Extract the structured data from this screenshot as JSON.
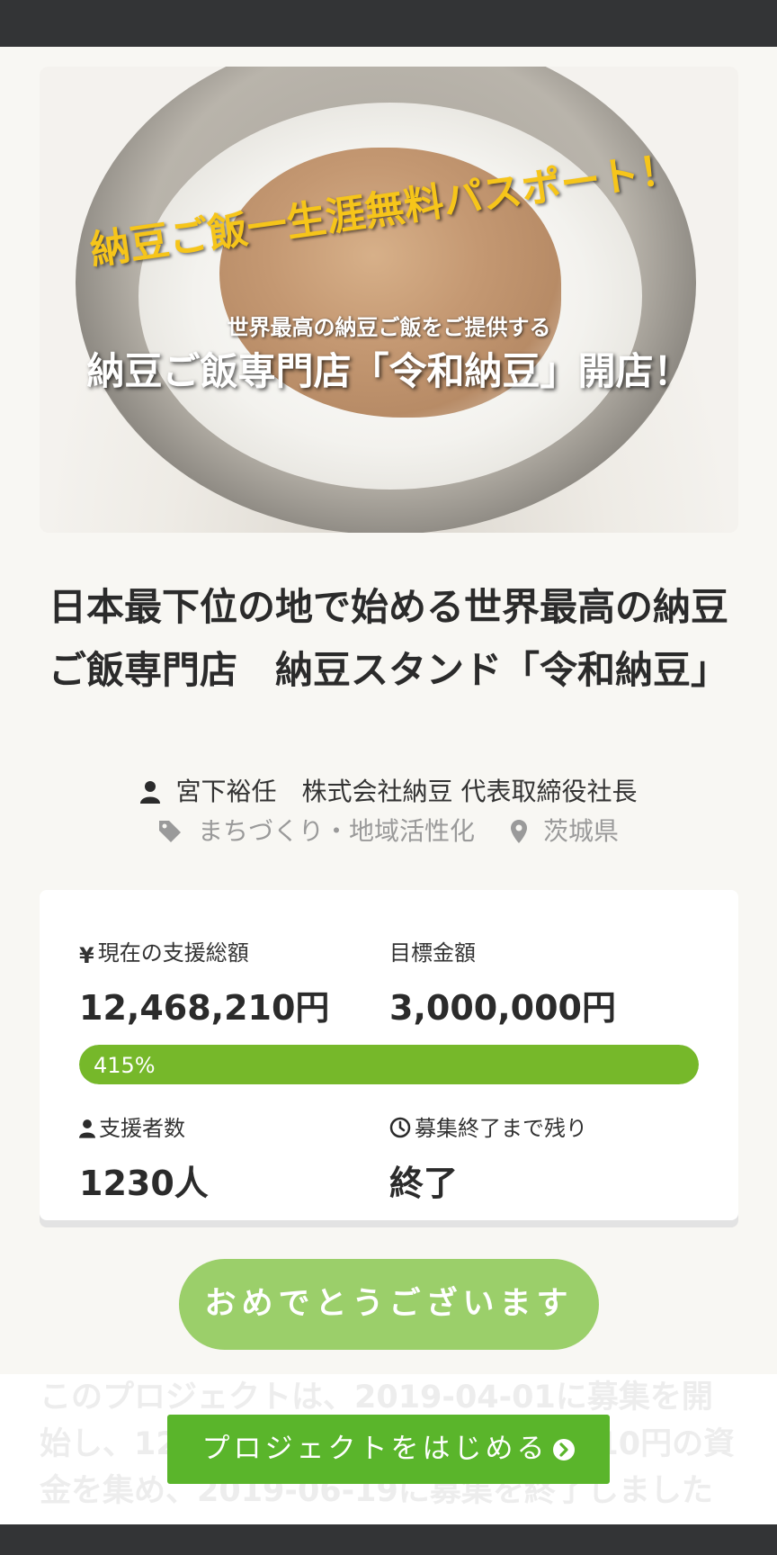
{
  "hero": {
    "curved_text": "納豆ご飯一生涯無料パスポート！",
    "subtitle": "世界最高の納豆ご飯をご提供する",
    "main_text": "納豆ご飯専門店「令和納豆」開店！"
  },
  "project": {
    "title": "日本最下位の地で始める世界最高の納豆ご飯専門店　納豆スタンド「令和納豆」",
    "owner": "宮下裕任　株式会社納豆 代表取締役社長",
    "category": "まちづくり・地域活性化",
    "location": "茨城県"
  },
  "stats": {
    "current_label": "現在の支援総額",
    "current_value": "12,468,210円",
    "goal_label": "目標金額",
    "goal_value": "3,000,000円",
    "progress_text": "415%",
    "progress_fraction": 1.0,
    "supporters_label": "支援者数",
    "supporters_value": "1230人",
    "remaining_label": "募集終了まで残り",
    "remaining_value": "終了"
  },
  "congrats_label": "おめでとうございます",
  "description": "このプロジェクトは、2019-04-01に募集を開始し、1230人の支援により12,468,210円の資金を集め、2019-06-19に募集を終了しました",
  "start_button_label": "プロジェクトをはじめる",
  "colors": {
    "accent_green": "#76b82a",
    "button_green": "#5ab52b",
    "congrats_green": "#9bcf6a",
    "dark_bar": "#333436"
  }
}
